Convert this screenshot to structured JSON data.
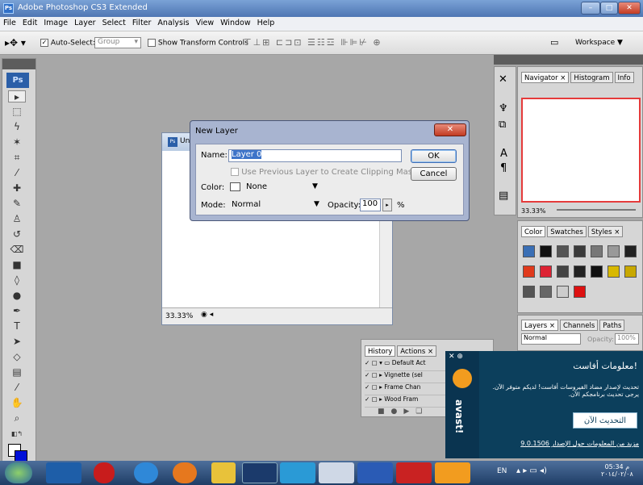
{
  "app": {
    "title": "Adobe Photoshop CS3 Extended",
    "icon_text": "Ps"
  },
  "menu": [
    "File",
    "Edit",
    "Image",
    "Layer",
    "Select",
    "Filter",
    "Analysis",
    "View",
    "Window",
    "Help"
  ],
  "options": {
    "auto_select_label": "Auto-Select:",
    "auto_select_value": "Group",
    "show_transform_label": "Show Transform Controls",
    "workspace_label": "Workspace ▼"
  },
  "toolbox": {
    "logo": "Ps"
  },
  "document": {
    "title": "Unt",
    "zoom": "33.33%"
  },
  "dialog": {
    "title": "New Layer",
    "name_label": "Name:",
    "name_value": "Layer 0",
    "clip_label": "Use Previous Layer to Create Clipping Mask",
    "color_label": "Color:",
    "color_value": "None",
    "mode_label": "Mode:",
    "mode_value": "Normal",
    "opacity_label": "Opacity:",
    "opacity_value": "100",
    "percent": "%",
    "ok_label": "OK",
    "cancel_label": "Cancel"
  },
  "navigator": {
    "tabs": [
      "Navigator ×",
      "Histogram",
      "Info"
    ],
    "zoom": "33.33%"
  },
  "styles": {
    "tabs": [
      "Color",
      "Swatches",
      "Styles ×"
    ]
  },
  "layers": {
    "tabs": [
      "Layers ×",
      "Channels",
      "Paths"
    ],
    "mode": "Normal",
    "opacity_label": "Opacity:",
    "opacity_value": "100%"
  },
  "history": {
    "tabs": [
      "History",
      "Actions ×"
    ],
    "items": [
      "Default Act",
      "Vignette (sel",
      "Frame Chan",
      "Wood Fram"
    ]
  },
  "avast": {
    "heading": "معلومات أفاست!",
    "message": "تحديث لإصدار مضاد الفيروسات أفاست! لديكم متوفر الآن. يرجى تحديث برنامجكم الآن.",
    "update_button": "التحديث الآن",
    "more_info_link": "مزيد من المعلومات حول الإصدار 9.0.1506",
    "brand": "avast!"
  },
  "taskbar": {
    "lang": "EN",
    "time": "05:34 م",
    "date": "٢٠١٤/٠٢/٠٨"
  }
}
